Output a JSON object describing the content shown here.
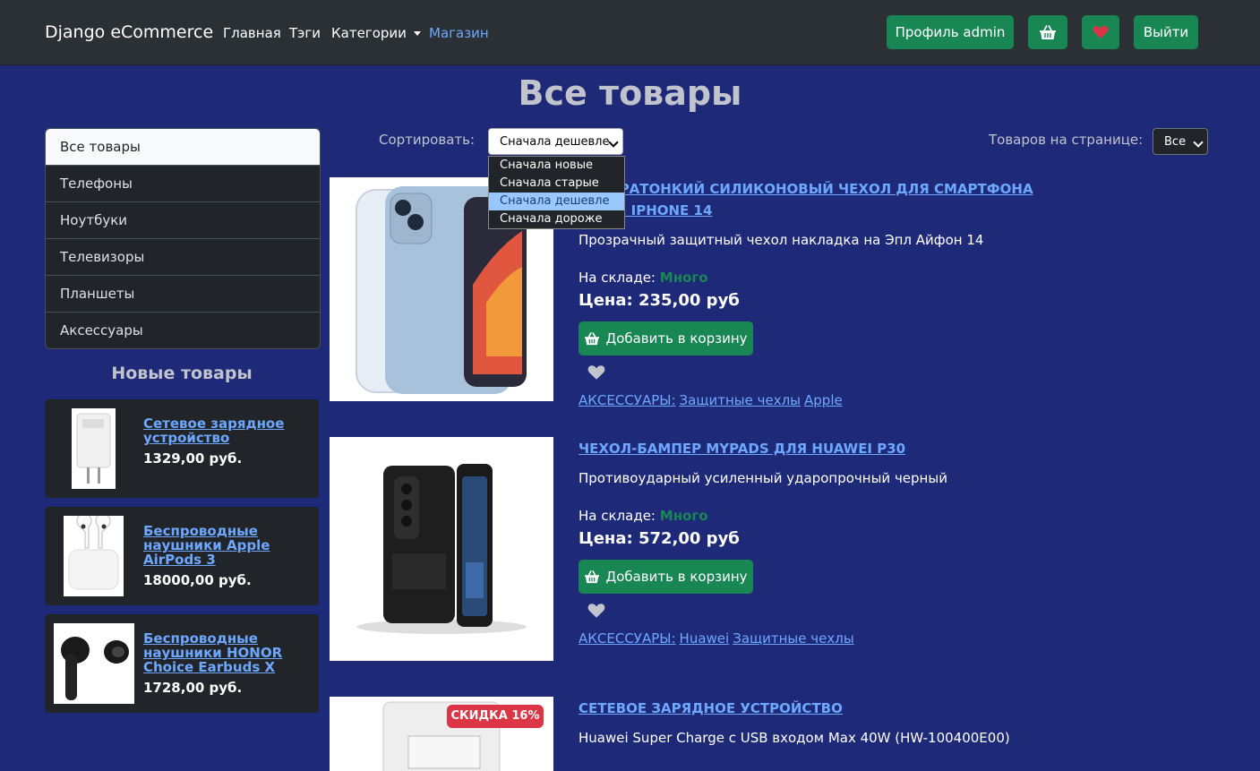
{
  "navbar": {
    "brand": "Django eCommerce",
    "links": [
      "Главная",
      "Тэги",
      "Категории",
      "Магазин"
    ],
    "profile_label": "Профиль admin",
    "logout_label": "Выйти"
  },
  "page": {
    "title": "Все товары"
  },
  "sidebar": {
    "categories": [
      "Все товары",
      "Телефоны",
      "Ноутбуки",
      "Телевизоры",
      "Планшеты",
      "Аксессуары"
    ],
    "new_title": "Новые товары",
    "new_items": [
      {
        "name": "Сетевое зарядное устройство",
        "price": "1329,00 руб."
      },
      {
        "name": "Беспроводные наушники Apple AirPods 3",
        "price": "18000,00 руб."
      },
      {
        "name": "Беспроводные наушники HONOR Choice Earbuds X",
        "price": "1728,00 руб."
      }
    ]
  },
  "controls": {
    "sort_label": "Сортировать:",
    "sort_value": "Сначала дешевле",
    "sort_options": [
      "Сначала новые",
      "Сначала старые",
      "Сначала дешевле",
      "Сначала дороже"
    ],
    "per_page_label": "Товаров на странице:",
    "per_page_value": "Все"
  },
  "products": [
    {
      "title_line1": "Ультратонкий силиконовый чехол для смартфона",
      "title_line2": "Apple iPhone 14",
      "desc": "Прозрачный защитный чехол накладка на Эпл Айфон 14",
      "stock_label": "На складе:",
      "stock_value": "Много",
      "price": "Цена: 235,00 руб",
      "add_label": "Добавить в корзину",
      "tags": [
        "АКСЕССУАРЫ:",
        "Защитные чехлы",
        "Apple"
      ]
    },
    {
      "title_line1": "Чехол-бампер MyPads для Huawei P30",
      "desc": "Противоударный усиленный ударопрочный черный",
      "stock_label": "На складе:",
      "stock_value": "Много",
      "price": "Цена: 572,00 руб",
      "add_label": "Добавить в корзину",
      "tags": [
        "АКСЕССУАРЫ:",
        "Huawei",
        "Защитные чехлы"
      ]
    },
    {
      "title_line1": "Сетевое зарядное устройство",
      "desc": "Huawei Super Charge с USB входом Max 40W (HW-100400E00)",
      "badge": "СКИДКА 16%"
    }
  ],
  "colors": {
    "bg": "#1e2a78",
    "navbar": "#2b3035",
    "success": "#198754",
    "link": "#6ea8fe",
    "danger": "#dc3545"
  },
  "icons": [
    "basket-icon",
    "heart-icon"
  ]
}
